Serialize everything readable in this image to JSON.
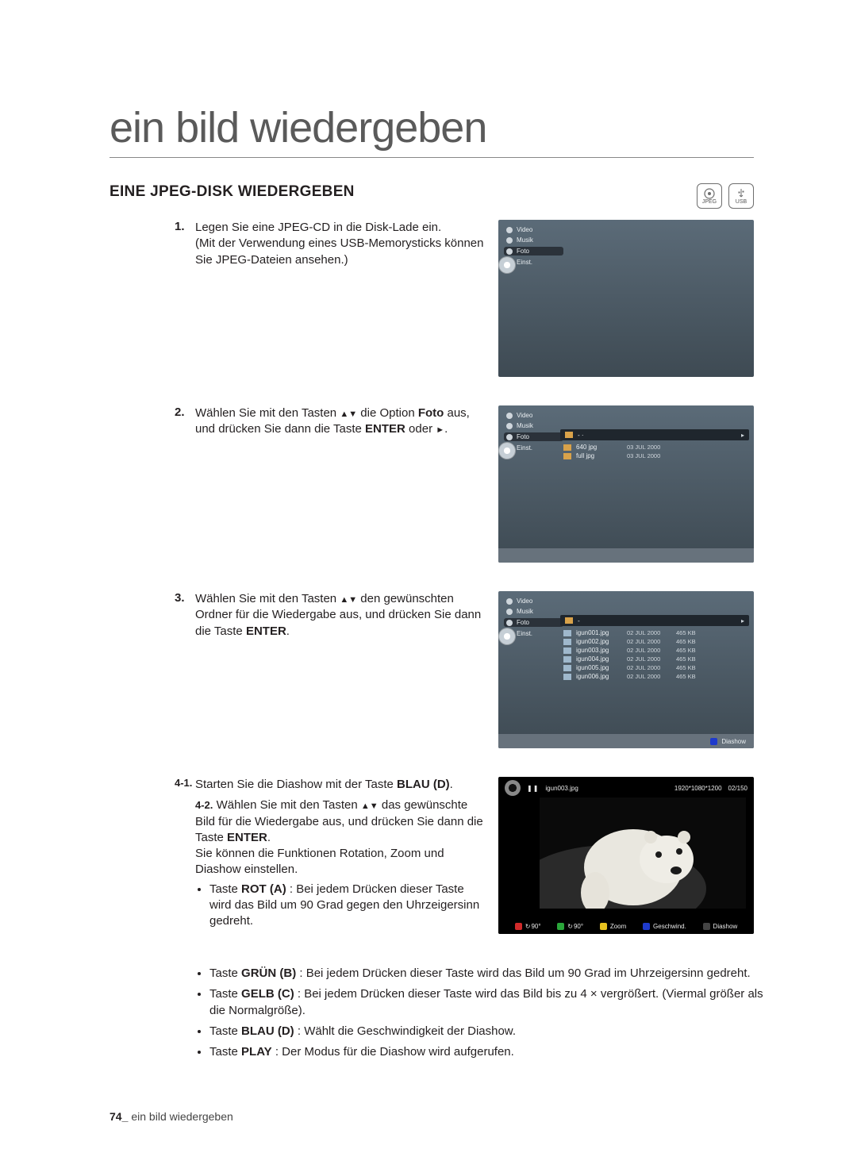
{
  "title": "ein bild wiedergeben",
  "section_header": "EINE JPEG-DISK WIEDERGEBEN",
  "badges": {
    "jpeg": "JPEG",
    "usb": "USB"
  },
  "tv_nav": {
    "video": "Video",
    "musik": "Musik",
    "foto": "Foto",
    "einst": "Einst.",
    "path_root": "-",
    "path_up": "- ·",
    "folders": [
      {
        "name": "640 jpg",
        "date": "03 JUL 2000"
      },
      {
        "name": "full jpg",
        "date": "03 JUL 2000"
      }
    ],
    "files": [
      {
        "name": "igun001.jpg",
        "date": "02 JUL 2000",
        "size": "465 KB"
      },
      {
        "name": "igun002.jpg",
        "date": "02 JUL 2000",
        "size": "465 KB"
      },
      {
        "name": "igun003.jpg",
        "date": "02 JUL 2000",
        "size": "465 KB"
      },
      {
        "name": "igun004.jpg",
        "date": "02 JUL 2000",
        "size": "465 KB"
      },
      {
        "name": "igun005.jpg",
        "date": "02 JUL 2000",
        "size": "465 KB"
      },
      {
        "name": "igun006.jpg",
        "date": "02 JUL 2000",
        "size": "465 KB"
      }
    ],
    "footer_diashow": "Diashow"
  },
  "photo": {
    "pause": "❚❚",
    "file": "igun003.jpg",
    "resolution": "1920*1080*1200",
    "index": "02/150",
    "buttons": {
      "rot_ccw": "90°",
      "rot_cw": "90°",
      "zoom": "Zoom",
      "speed": "Geschwind.",
      "diashow": "Diashow"
    }
  },
  "steps": {
    "s1": {
      "num": "1.",
      "a": "Legen Sie eine JPEG-CD in die Disk-Lade ein.",
      "b": "(Mit der Verwendung eines USB-Memorysticks können Sie JPEG-Dateien ansehen.)"
    },
    "s2": {
      "num": "2.",
      "a1": "Wählen Sie mit den Tasten ",
      "a2": " die Option ",
      "foto": "Foto",
      "a3": " aus, und drücken Sie dann die Taste ",
      "enter": "ENTER",
      "a4": " oder "
    },
    "s3": {
      "num": "3.",
      "a1": "Wählen Sie mit den Tasten ",
      "a2": " den gewünschten Ordner für die Wiedergabe aus, und drücken Sie dann die Taste ",
      "enter": "ENTER",
      "a3": "."
    },
    "s4a": {
      "num": "4-1.",
      "a1": "Starten Sie die Diashow mit der Taste ",
      "blau": "BLAU (D)",
      "a2": "."
    },
    "s4b": {
      "num": "4-2.",
      "a1": "Wählen Sie mit den Tasten ",
      "a2": " das gewünschte Bild für die Wiedergabe aus, und drücken Sie dann die Taste ",
      "enter": "ENTER",
      "a3": ".",
      "b": "Sie können die Funktionen Rotation, Zoom und Diashow einstellen."
    },
    "bullets": {
      "b1a": "Taste ",
      "b1b": "ROT (A)",
      "b1c": " : Bei jedem Drücken dieser Taste wird das Bild um 90 Grad gegen den Uhrzeigersinn gedreht.",
      "b2a": "Taste ",
      "b2b": "GRÜN (B)",
      "b2c": " : Bei jedem Drücken dieser Taste wird das Bild um 90 Grad im Uhrzeigersinn gedreht.",
      "b3a": "Taste ",
      "b3b": "GELB (C)",
      "b3c": " : Bei jedem Drücken dieser Taste wird das Bild bis zu 4 × vergrößert. (Viermal größer als die Normalgröße).",
      "b4a": "Taste ",
      "b4b": "BLAU (D)",
      "b4c": " : Wählt die Geschwindigkeit der Diashow.",
      "b5a": "Taste ",
      "b5b": "PLAY",
      "b5c": " : Der Modus für die Diashow wird aufgerufen."
    }
  },
  "footer": {
    "page": "74_",
    "label": "ein bild wiedergeben"
  }
}
